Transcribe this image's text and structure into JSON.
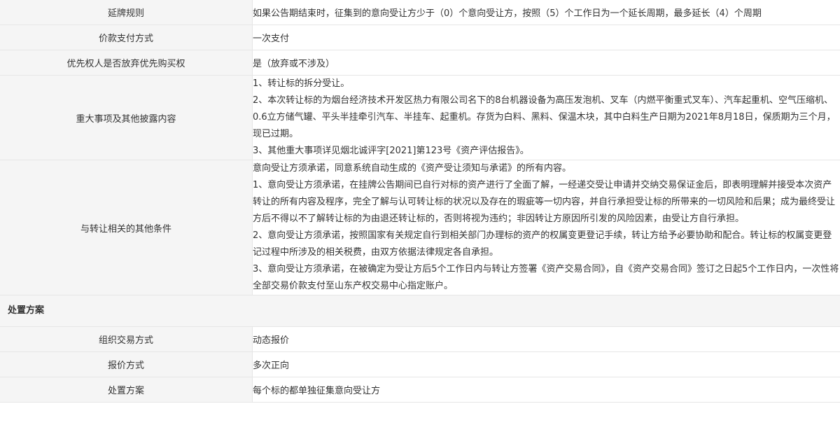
{
  "rows_top": [
    {
      "label": "延牌规则",
      "value": "如果公告期结束时，征集到的意向受让方少于（0）个意向受让方，按照（5）个工作日为一个延长周期，最多延长（4）个周期"
    },
    {
      "label": "价款支付方式",
      "value": "一次支付"
    },
    {
      "label": "优先权人是否放弃优先购买权",
      "value": "是（放弃或不涉及）"
    }
  ],
  "major_matters": {
    "label": "重大事项及其他披露内容",
    "lines": [
      "1、转让标的拆分受让。",
      "2、本次转让标的为烟台经济技术开发区热力有限公司名下的8台机器设备为高压发泡机、叉车（内燃平衡重式叉车）、汽车起重机、空气压缩机、0.6立方储气罐、平头半挂牵引汽车、半挂车、起重机。存货为白料、黑料、保温木块，其中白料生产日期为2021年8月18日，保质期为三个月，现已过期。",
      "3、其他重大事项详见烟北诚评字[2021]第123号《资产评估报告》。"
    ]
  },
  "other_conditions": {
    "label": "与转让相关的其他条件",
    "lines": [
      "意向受让方须承诺，同意系统自动生成的《资产受让须知与承诺》的所有内容。",
      "1、意向受让方须承诺，在挂牌公告期间已自行对标的资产进行了全面了解，一经递交受让申请并交纳交易保证金后，即表明理解并接受本次资产转让的所有内容及程序，完全了解与认可转让标的状况以及存在的瑕疵等一切内容，并自行承担受让标的所带来的一切风险和后果；成为最终受让方后不得以不了解转让标的为由退还转让标的，否则将视为违约；非因转让方原因所引发的风险因素，由受让方自行承担。",
      "2、意向受让方须承诺，按照国家有关规定自行到相关部门办理标的资产的权属变更登记手续，转让方给予必要协助和配合。转让标的权属变更登记过程中所涉及的相关税费，由双方依据法律规定各自承担。",
      "3、意向受让方须承诺，在被确定为受让方后5个工作日内与转让方签署《资产交易合同》，自《资产交易合同》签订之日起5个工作日内，一次性将全部交易价款支付至山东产权交易中心指定账户。"
    ]
  },
  "section_title": "处置方案",
  "rows_bottom": [
    {
      "label": "组织交易方式",
      "value": "动态报价"
    },
    {
      "label": "报价方式",
      "value": "多次正向"
    },
    {
      "label": "处置方案",
      "value": "每个标的都单独征集意向受让方"
    }
  ]
}
